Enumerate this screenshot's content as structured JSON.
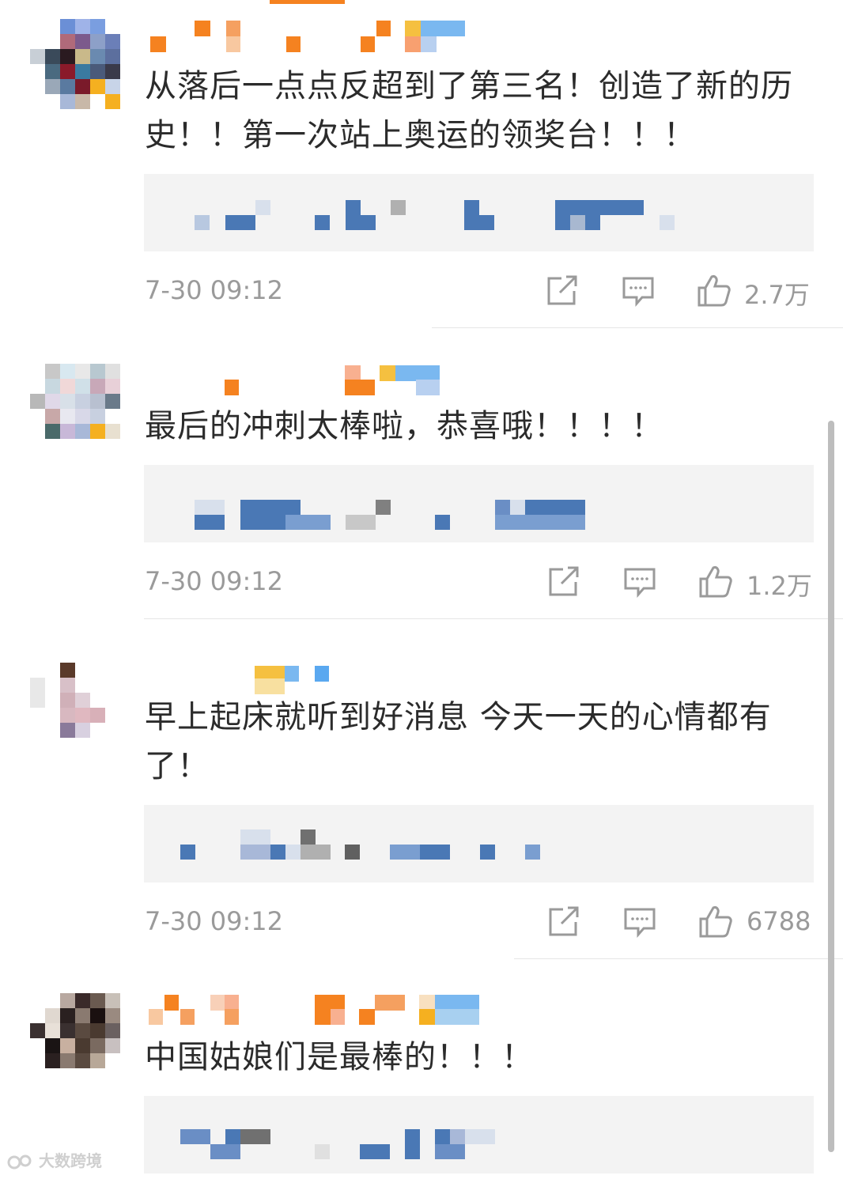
{
  "comments": [
    {
      "text": "从落后一点点反超到了第三名！创造了新的历史！！第一次站上奥运的领奖台！！！",
      "time": "7-30 09:12",
      "likes": "2.7万"
    },
    {
      "text": "最后的冲刺太棒啦，恭喜哦！！！！",
      "time": "7-30 09:12",
      "likes": "1.2万"
    },
    {
      "text": "早上起床就听到好消息 今天一天的心情都有了！",
      "time": "7-30 09:12",
      "likes": "6788"
    },
    {
      "text": "中国姑娘们是最棒的！！！"
    }
  ],
  "icons": {
    "share": "share-icon",
    "comment": "comment-icon",
    "like": "thumbs-up-icon"
  },
  "watermark": "大数跨境",
  "colors": {
    "text": "#2b2b2b",
    "meta": "#9a9a9a",
    "quote_bg": "#f3f3f3",
    "accent": "#f58220",
    "blue": "#4a78b5"
  }
}
